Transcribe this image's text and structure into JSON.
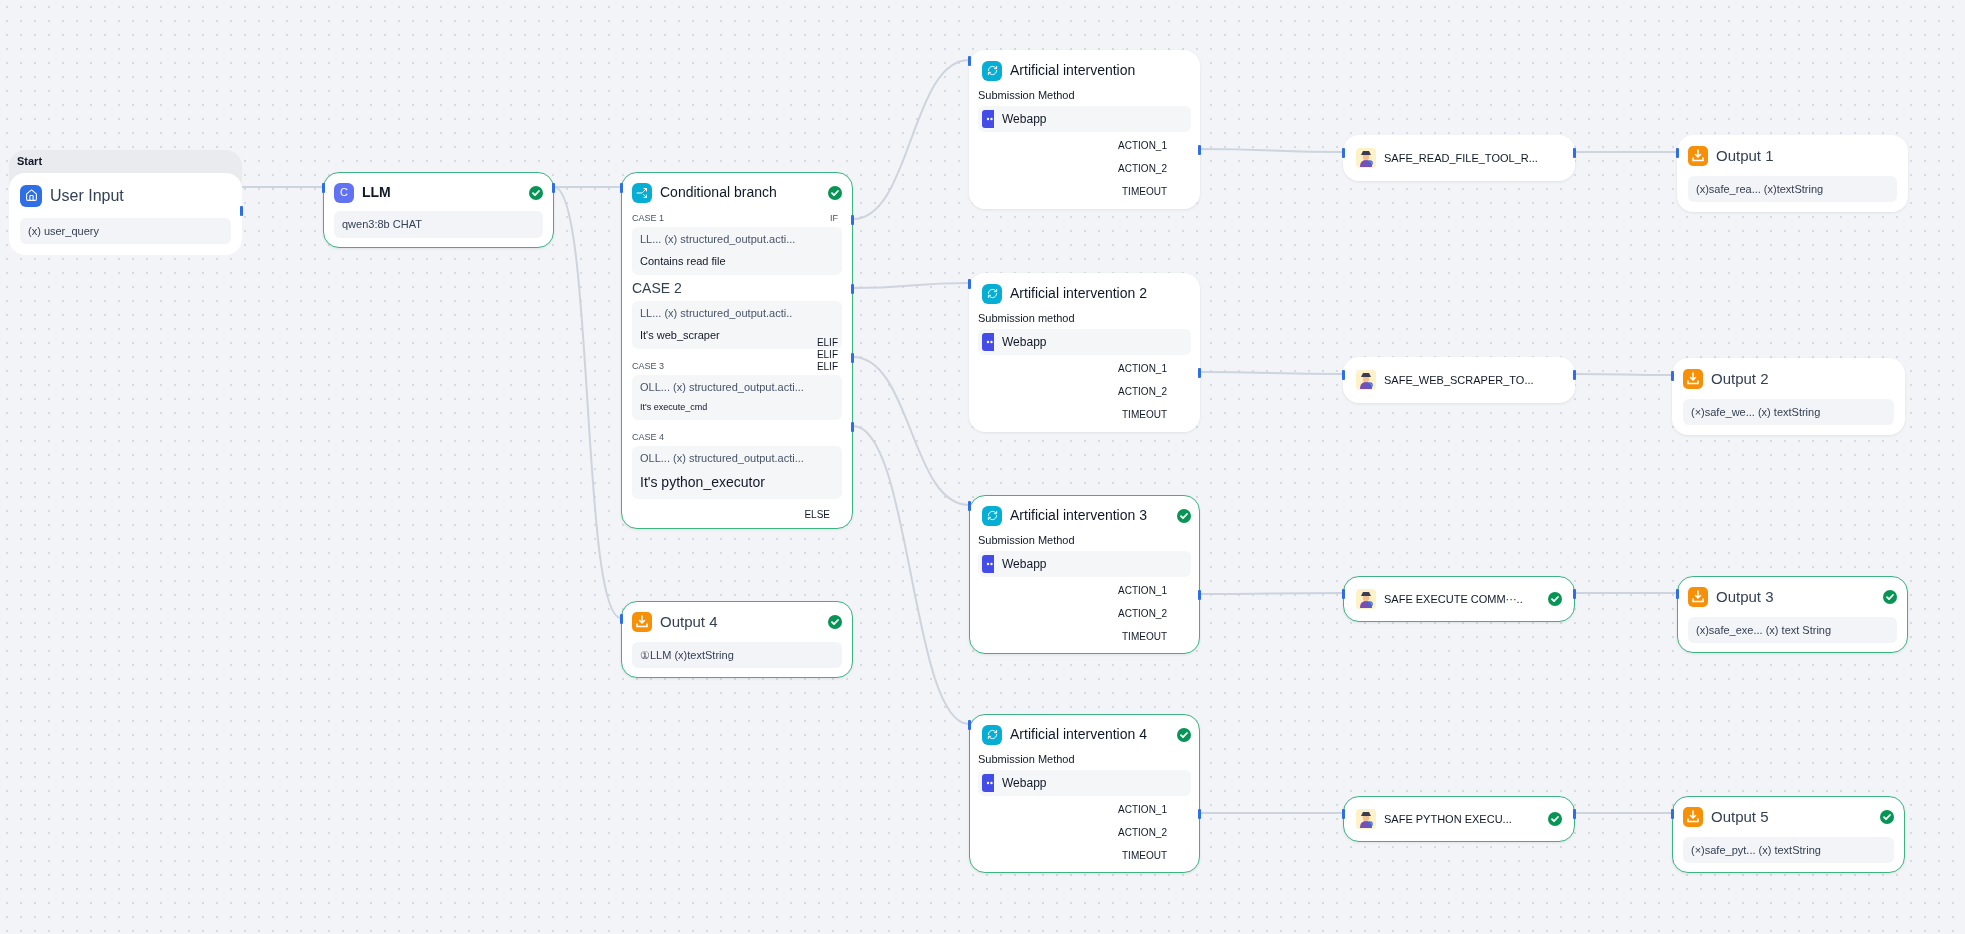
{
  "nodes": [
    {
      "kind": "start",
      "group_label": "Start",
      "title": "User Input",
      "variables": [
        "(x) user_query"
      ],
      "succeeded": false
    },
    {
      "kind": "llm",
      "icon_letter": "C",
      "title": "LLM",
      "variables": [
        "qwen3:8b CHAT"
      ],
      "succeeded": true
    },
    {
      "kind": "condition",
      "title": "Conditional branch",
      "succeeded": true,
      "cases": [
        {
          "label": "CASE 1",
          "variable": "LL... (x) structured_output.acti...",
          "value": "Contains read file"
        },
        {
          "label": "CASE 2",
          "variable": "LL... (x) structured_output.acti..",
          "value": "It's web_scraper"
        },
        {
          "label": "CASE 3",
          "variable": "OLL... (x) structured_output.acti...",
          "value": "It's execute_cmd"
        },
        {
          "label": "CASE 4",
          "variable": "OLL... (x) structured_output.acti...",
          "value": "It's python_executor"
        }
      ],
      "branches": [
        "IF",
        "ELIF",
        "ELIF",
        "ELIF",
        "ELSE"
      ]
    },
    {
      "kind": "output",
      "title": "Output 4",
      "variables": [
        "①LLM (x)textString"
      ],
      "succeeded": true
    },
    {
      "kind": "intervention",
      "title": "Artificial intervention",
      "method_label": "Submission Method",
      "method": "Webapp",
      "actions": [
        "ACTION_1",
        "ACTION_2",
        "TIMEOUT"
      ],
      "succeeded": false
    },
    {
      "kind": "intervention",
      "title": "Artificial intervention 2",
      "method_label": "Submission method",
      "method": "Webapp",
      "actions": [
        "ACTION_1",
        "ACTION_2",
        "TIMEOUT"
      ],
      "succeeded": false
    },
    {
      "kind": "intervention",
      "title": "Artificial intervention 3",
      "method_label": "Submission Method",
      "method": "Webapp",
      "actions": [
        "ACTION_1",
        "ACTION_2",
        "TIMEOUT"
      ],
      "succeeded": true
    },
    {
      "kind": "intervention",
      "title": "Artificial intervention 4",
      "method_label": "Submission Method",
      "method": "Webapp",
      "actions": [
        "ACTION_1",
        "ACTION_2",
        "TIMEOUT"
      ],
      "succeeded": true
    },
    {
      "kind": "tool",
      "title": "SAFE_READ_FILE_TOOL_R...",
      "succeeded": false
    },
    {
      "kind": "tool",
      "title": "SAFE_WEB_SCRAPER_TO...",
      "succeeded": false
    },
    {
      "kind": "tool",
      "title": "SAFE EXECUTE COMM···..",
      "succeeded": true
    },
    {
      "kind": "tool",
      "title": "SAFE PYTHON EXECU...",
      "succeeded": true
    },
    {
      "kind": "output",
      "title": "Output 1",
      "variables": [
        "(x)safe_rea... (x)textString"
      ],
      "succeeded": false
    },
    {
      "kind": "output",
      "title": "Output 2",
      "variables": [
        "(×)safe_we... (x) textString"
      ],
      "succeeded": false
    },
    {
      "kind": "output",
      "title": "Output 3",
      "variables": [
        "(x)safe_exe... (x) text String"
      ],
      "succeeded": true
    },
    {
      "kind": "output",
      "title": "Output 5",
      "variables": [
        "(×)safe_pyt... (x) textString"
      ],
      "succeeded": true
    }
  ]
}
